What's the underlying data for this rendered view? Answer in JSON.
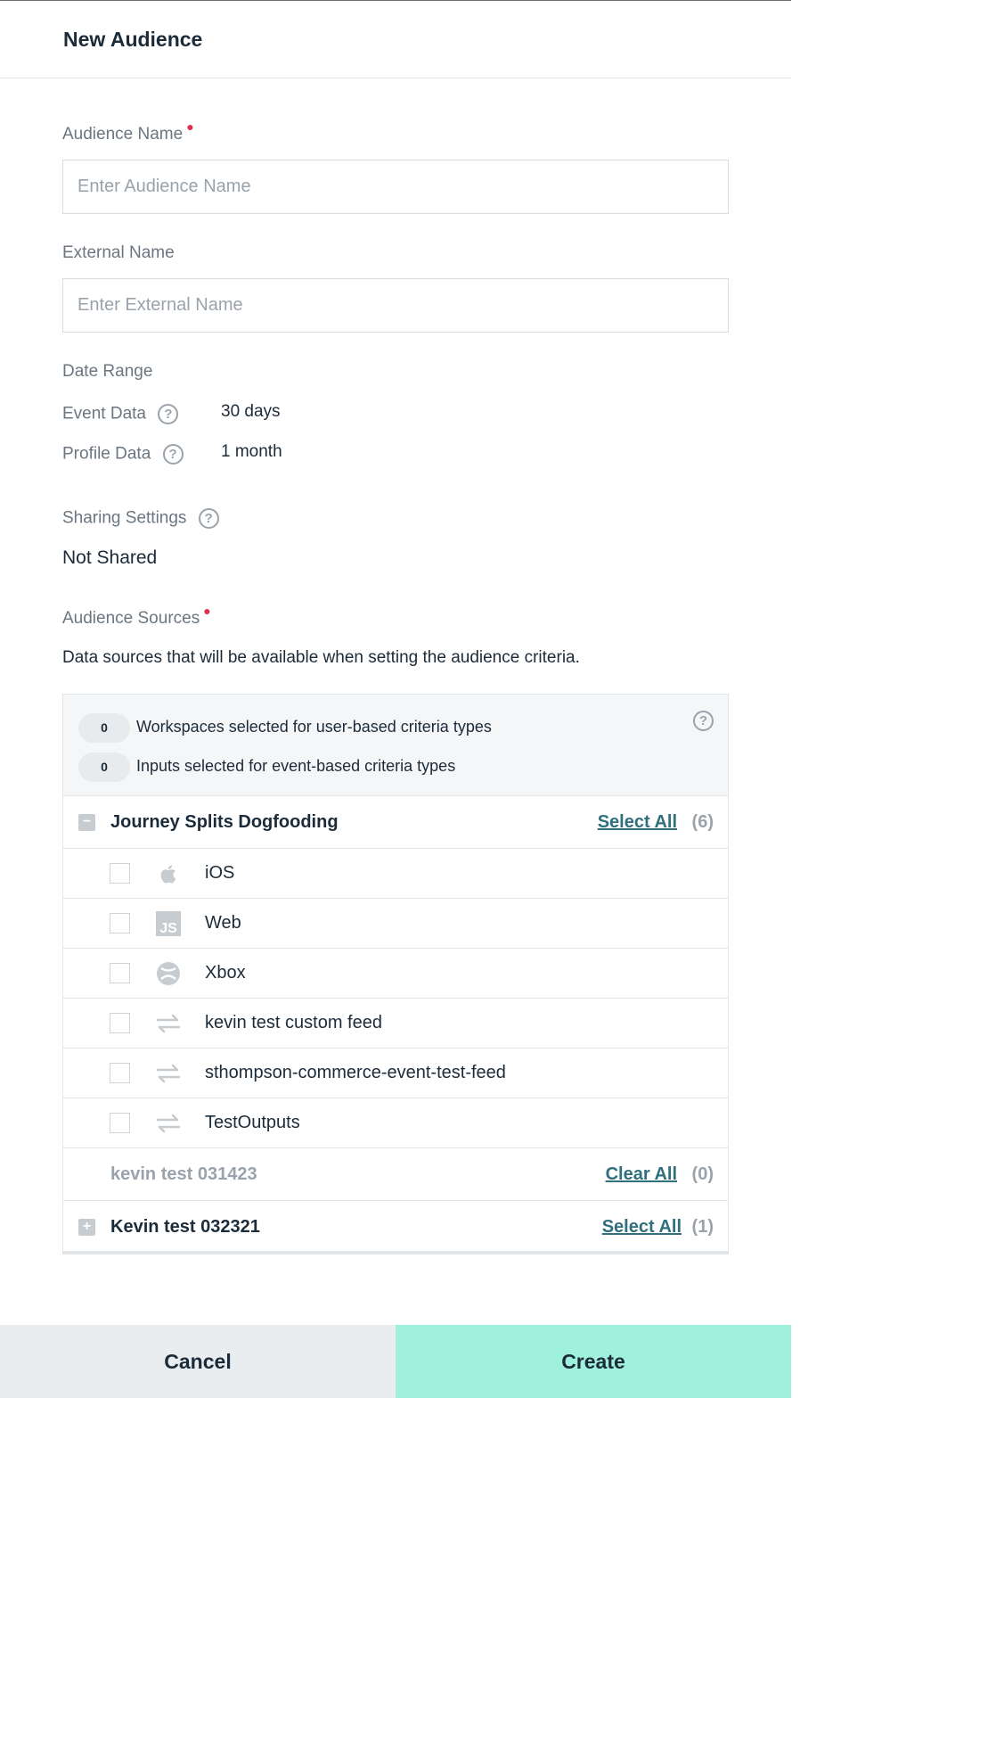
{
  "header": {
    "title": "New Audience"
  },
  "audience_name": {
    "label": "Audience Name",
    "placeholder": "Enter Audience Name",
    "value": ""
  },
  "external_name": {
    "label": "External Name",
    "placeholder": "Enter External Name",
    "value": ""
  },
  "date_range": {
    "label": "Date Range",
    "event_data": {
      "label": "Event Data",
      "value": "30 days"
    },
    "profile_data": {
      "label": "Profile Data",
      "value": "1 month"
    }
  },
  "sharing": {
    "label": "Sharing Settings",
    "value": "Not Shared"
  },
  "sources": {
    "label": "Audience Sources",
    "description": "Data sources that will be available when setting the audience criteria.",
    "summary": {
      "workspaces_count": "0",
      "workspaces_text": "Workspaces selected for user-based criteria types",
      "inputs_count": "0",
      "inputs_text": "Inputs selected for event-based criteria types"
    },
    "groups": [
      {
        "name": "Journey Splits Dogfooding",
        "action": "Select All",
        "count": "(6)",
        "items": [
          {
            "name": "iOS",
            "icon": "apple-icon"
          },
          {
            "name": "Web",
            "icon": "javascript-icon"
          },
          {
            "name": "Xbox",
            "icon": "xbox-icon"
          },
          {
            "name": "kevin test custom feed",
            "icon": "feed-arrows-icon"
          },
          {
            "name": "sthompson-commerce-event-test-feed",
            "icon": "feed-arrows-icon"
          },
          {
            "name": "TestOutputs",
            "icon": "feed-arrows-icon"
          }
        ]
      },
      {
        "name": "kevin test 031423",
        "action": "Clear All",
        "count": "(0)"
      },
      {
        "name": "Kevin test 032321",
        "action": "Select All",
        "count": "(1)"
      }
    ]
  },
  "footer": {
    "cancel": "Cancel",
    "create": "Create"
  },
  "colors": {
    "accent": "#9ff0dc",
    "link": "#2f6f7e",
    "required": "#e0304e"
  }
}
